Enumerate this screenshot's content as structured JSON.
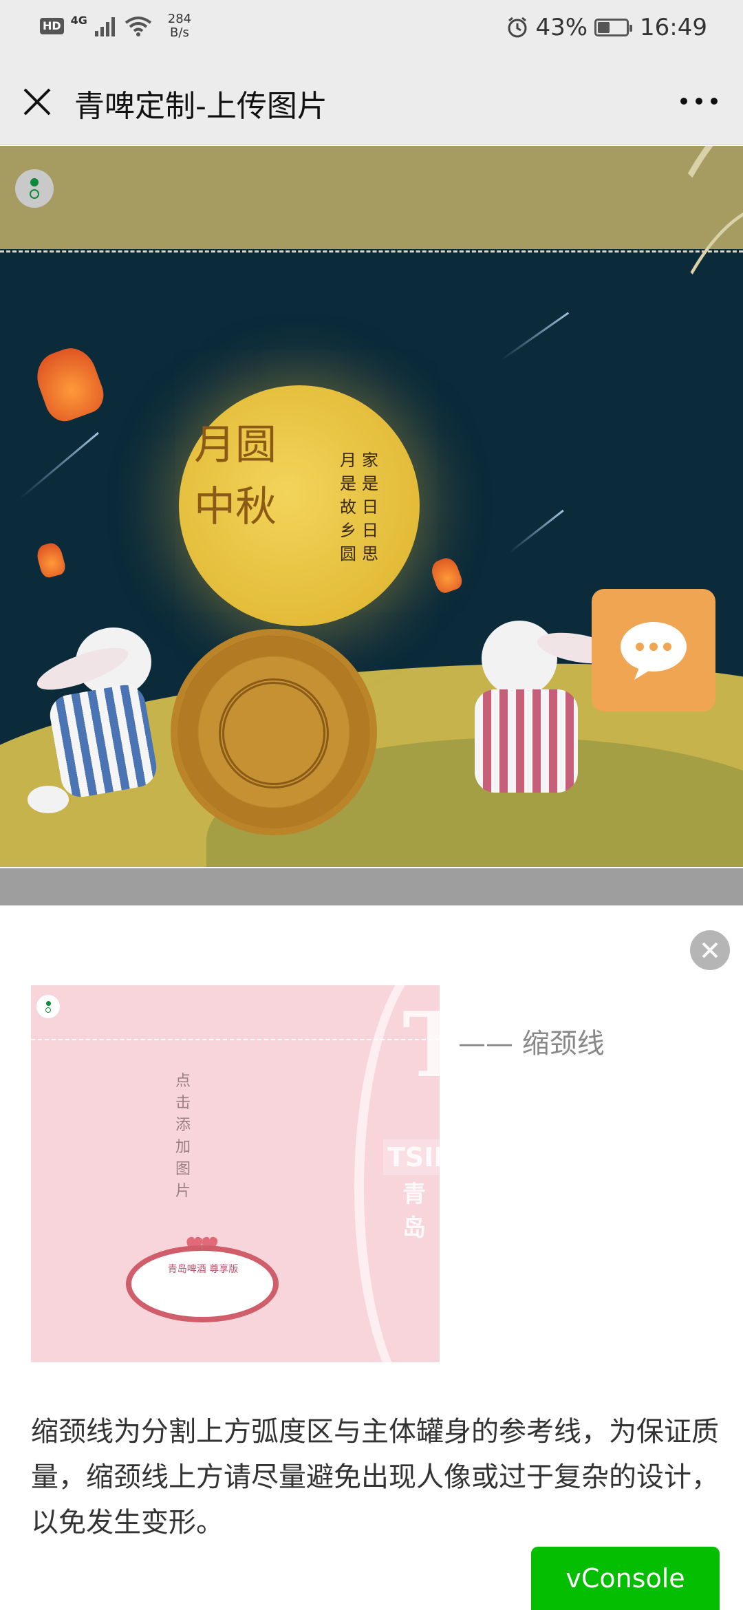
{
  "status_bar": {
    "hd": "HD",
    "network_type": "4G",
    "net_speed_value": "284",
    "net_speed_unit": "B/s",
    "battery": "43%",
    "battery_level_percent": 43,
    "time": "16:49",
    "icons": [
      "signal-icon",
      "wifi-icon",
      "alarm-icon",
      "battery-icon"
    ]
  },
  "nav": {
    "title": "青啤定制-上传图片",
    "close_icon": "close-icon",
    "more_icon": "more-icon"
  },
  "banner": {
    "calligraphy": "月圆中秋",
    "poem_col1": [
      "家",
      "是",
      "日",
      "日",
      "思"
    ],
    "poem_col2": [
      "月",
      "是",
      "故",
      "乡",
      "圆"
    ],
    "chat_icon": "chat-bubble-icon"
  },
  "sheet": {
    "close_icon": "close-circle-icon",
    "neck_label": "—— 缩颈线",
    "preview": {
      "vertical_text": [
        "点",
        "击",
        "添",
        "加",
        "图",
        "片"
      ],
      "oval_text": "青岛啤酒 尊享版",
      "brand_letter": "T",
      "brand_tsin": "TSIN",
      "brand_cn": "青岛"
    },
    "description": "缩颈线为分割上方弧度区与主体罐身的参考线，为保证质量，缩颈线上方请尽量避免出现人像或过于复杂的设计，以免发生变形。",
    "vconsole": "vConsole"
  },
  "colors": {
    "accent_orange": "#f0a552",
    "vconsole_green": "#04be02",
    "preview_pink": "#f7d5db",
    "banner_navy": "#0b2a3a",
    "moon_gold": "#e9c541"
  }
}
